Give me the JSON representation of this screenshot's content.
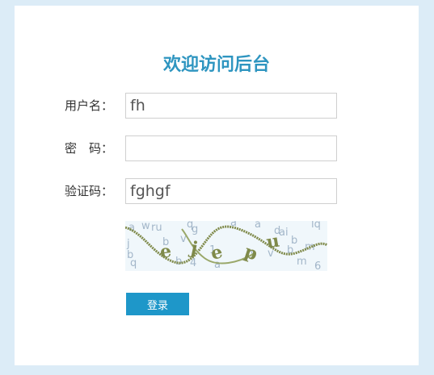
{
  "header": {
    "title": "欢迎访问后台"
  },
  "form": {
    "username_label": "用户名：",
    "username_value": "fh",
    "password_label": "密　码：",
    "password_value": "",
    "captcha_label": "验证码：",
    "captcha_value": "fghgf",
    "captcha_text": "ejepu",
    "login_label": "登录"
  },
  "colors": {
    "page_bg": "#dcecf7",
    "accent": "#2e95c0",
    "button": "#1e97c9",
    "captcha_text": "#7f8a4a"
  }
}
